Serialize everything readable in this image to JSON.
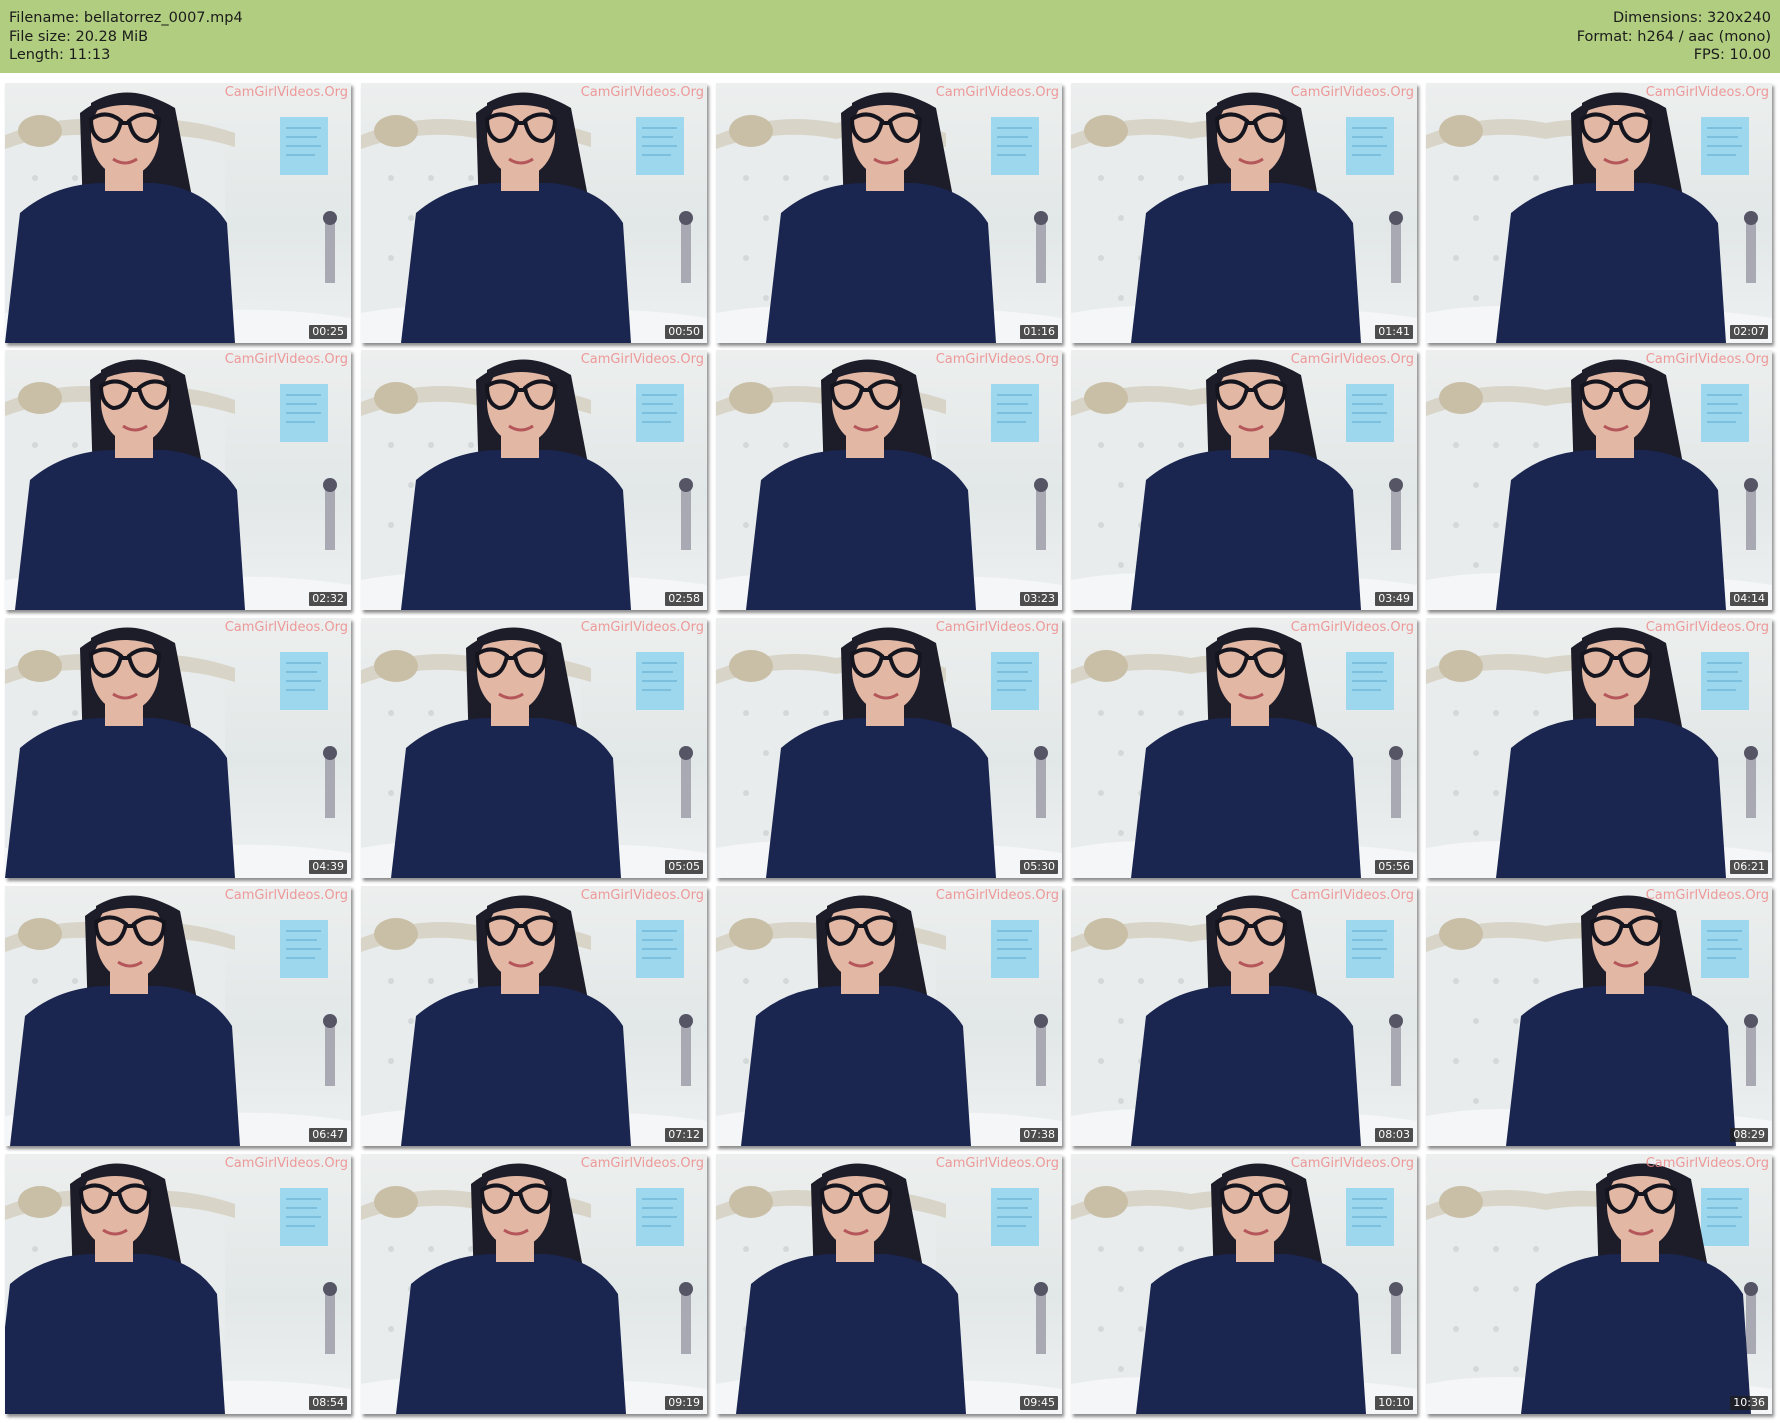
{
  "header": {
    "filename": "Filename: bellatorrez_0007.mp4",
    "filesize": "File size: 20.28 MiB",
    "length": "Length: 11:13",
    "dimensions": "Dimensions: 320x240",
    "format": "Format: h264 / aac (mono)",
    "fps": "FPS: 10.00"
  },
  "watermark": "CamGirlVideos.Org",
  "colors": {
    "header_bg": "#b1cd80",
    "shirt": "#1a2550",
    "hair": "#1d1d2a",
    "skin": "#e2b8a4",
    "headboard": "#e9ecec",
    "poster": "#8fd3ef",
    "watermark": "#ee8a8a"
  },
  "thumbnails": [
    {
      "time": "00:25"
    },
    {
      "time": "00:50"
    },
    {
      "time": "01:16"
    },
    {
      "time": "01:41"
    },
    {
      "time": "02:07"
    },
    {
      "time": "02:32"
    },
    {
      "time": "02:58"
    },
    {
      "time": "03:23"
    },
    {
      "time": "03:49"
    },
    {
      "time": "04:14"
    },
    {
      "time": "04:39"
    },
    {
      "time": "05:05"
    },
    {
      "time": "05:30"
    },
    {
      "time": "05:56"
    },
    {
      "time": "06:21"
    },
    {
      "time": "06:47"
    },
    {
      "time": "07:12"
    },
    {
      "time": "07:38"
    },
    {
      "time": "08:03"
    },
    {
      "time": "08:29"
    },
    {
      "time": "08:54"
    },
    {
      "time": "09:19"
    },
    {
      "time": "09:45"
    },
    {
      "time": "10:10"
    },
    {
      "time": "10:36"
    }
  ]
}
